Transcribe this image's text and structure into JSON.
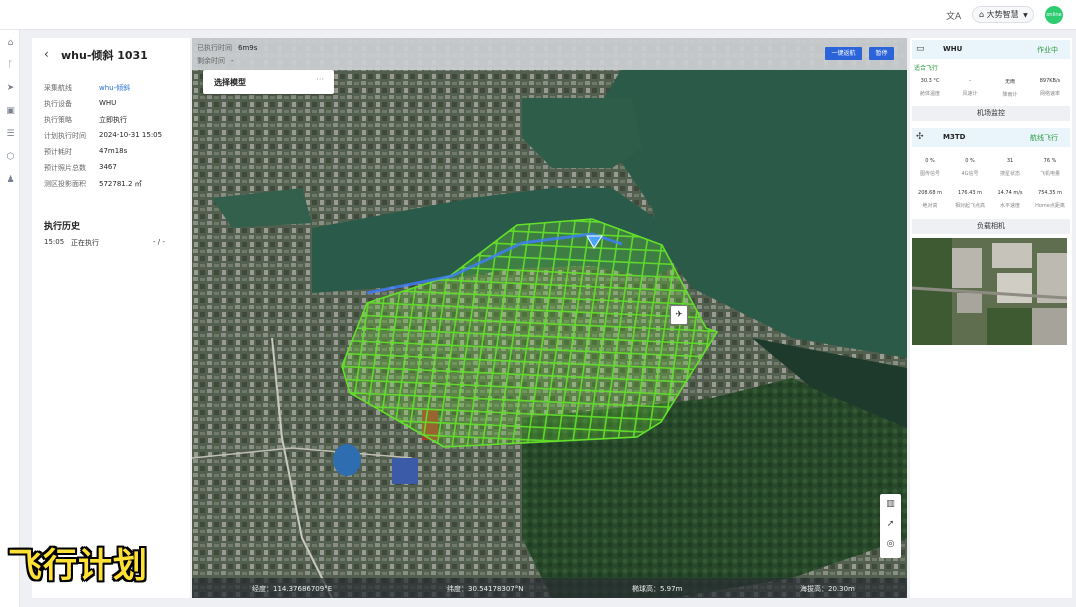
{
  "topbar": {
    "translate_icon": "translate-icon",
    "user_label": "大势智慧",
    "avatar_text": "online"
  },
  "rail": {
    "icons": [
      "home-icon",
      "branch-icon",
      "send-icon",
      "image-icon",
      "list-icon",
      "cube-icon",
      "users-icon"
    ]
  },
  "task": {
    "title": "whu-倾斜 1031",
    "fields": [
      {
        "label": "采集航线",
        "value": "whu-倾斜",
        "link": true
      },
      {
        "label": "执行设备",
        "value": "WHU"
      },
      {
        "label": "执行策略",
        "value": "立即执行"
      },
      {
        "label": "计划执行时间",
        "value": "2024-10-31 15:05"
      },
      {
        "label": "预计耗时",
        "value": "47m18s"
      },
      {
        "label": "预计照片总数",
        "value": "3467"
      },
      {
        "label": "测区投影面积",
        "value": "572781.2 ㎡"
      }
    ],
    "history_title": "执行历史",
    "history": [
      {
        "time": "15:05",
        "status": "正在执行",
        "extra": "- / -"
      }
    ]
  },
  "map": {
    "elapsed_label": "已执行时间",
    "elapsed_value": "6m9s",
    "remaining_label": "剩余时间",
    "remaining_value": "-",
    "btn_return": "一键返航",
    "btn_pause": "暂停",
    "model_select_label": "选择模型",
    "model_select_more": "···",
    "status_bar": {
      "longitude": "经度：114.37686709°E",
      "latitude": "纬度：30.54178307°N",
      "ellipsoid_height": "椭球高：5.97m",
      "altitude": "海拔高：20.30m"
    }
  },
  "dock": {
    "name": "WHU",
    "status": "作业中",
    "substatus": "适合飞行",
    "stats": [
      {
        "value": "30.3 °C",
        "label": "舱体温度"
      },
      {
        "value": "-",
        "label": "风速计"
      },
      {
        "value": "无雨",
        "label": "降雨计"
      },
      {
        "value": "897KB/s",
        "label": "网络速率"
      }
    ],
    "monitor_button": "机场监控"
  },
  "drone": {
    "name": "M3TD",
    "status": "航线飞行",
    "stats_row1": [
      {
        "value": "0 %",
        "label": "图传信号"
      },
      {
        "value": "0 %",
        "label": "4G信号"
      },
      {
        "value": "31",
        "label": "搜星状态"
      },
      {
        "value": "76 %",
        "label": "飞机电量"
      }
    ],
    "stats_row2": [
      {
        "value": "208.68 m",
        "label": "绝对高"
      },
      {
        "value": "176.43 m",
        "label": "相对起飞点高"
      },
      {
        "value": "14.74 m/s",
        "label": "水平速度"
      },
      {
        "value": "754.35 m",
        "label": "Home点距离"
      }
    ],
    "camera_button": "负载相机"
  },
  "caption": "飞行计划"
}
